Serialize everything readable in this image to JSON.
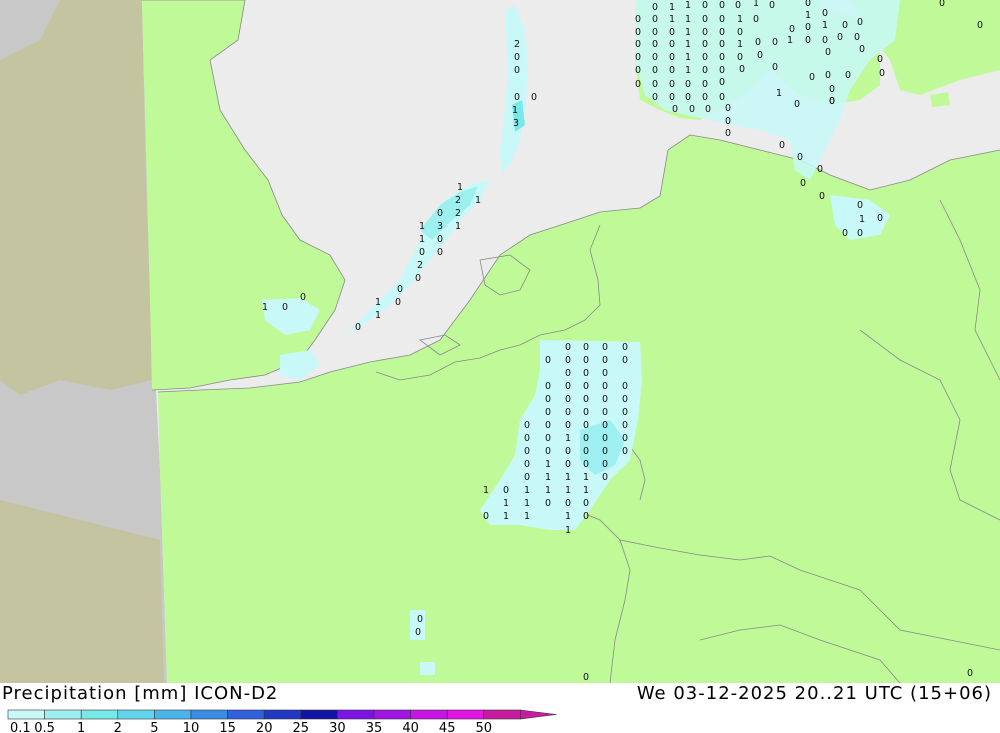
{
  "title": {
    "left": "Precipitation [mm] ICON-D2",
    "right": "We 03-12-2025 20..21 UTC (15+06)"
  },
  "colors": {
    "sea": "#ececec",
    "land": "#c0fa98",
    "outside_domain": "#c8c8c8",
    "out_land": "#c4c4a0",
    "border": "#888888"
  },
  "legend": {
    "ticks": [
      "0.1",
      "0.5",
      "1",
      "2",
      "5",
      "10",
      "15",
      "20",
      "25",
      "30",
      "35",
      "40",
      "45",
      "50"
    ],
    "colors": [
      "#c8f8f8",
      "#9ef0f0",
      "#78e8e8",
      "#64d4ec",
      "#4cb4ec",
      "#3c8ce4",
      "#3060dc",
      "#2038c4",
      "#1414a4",
      "#7c14e4",
      "#a014e4",
      "#c814e4",
      "#e414e4",
      "#c81ca0"
    ]
  },
  "values": [
    {
      "t": "0"
    },
    {
      "t": "1"
    },
    {
      "t": "1"
    },
    {
      "t": "0"
    },
    {
      "t": "0"
    },
    {
      "t": "0"
    },
    {
      "t": "1"
    },
    {
      "t": "0"
    },
    {
      "t": "0"
    },
    {
      "t": "0"
    },
    {
      "t": "0"
    },
    {
      "t": "0"
    },
    {
      "t": "1"
    },
    {
      "t": "1"
    },
    {
      "t": "0"
    },
    {
      "t": "0"
    },
    {
      "t": "1"
    },
    {
      "t": "0"
    },
    {
      "t": "1"
    },
    {
      "t": "0"
    },
    {
      "t": "0"
    },
    {
      "t": "0"
    },
    {
      "t": "0"
    },
    {
      "t": "0"
    },
    {
      "t": "0"
    },
    {
      "t": "1"
    },
    {
      "t": "0"
    },
    {
      "t": "0"
    },
    {
      "t": "0"
    },
    {
      "t": "0"
    },
    {
      "t": "0"
    },
    {
      "t": "1"
    },
    {
      "t": "0"
    },
    {
      "t": "0"
    },
    {
      "t": "0"
    },
    {
      "t": "0"
    },
    {
      "t": "0"
    },
    {
      "t": "1"
    },
    {
      "t": "0"
    },
    {
      "t": "0"
    },
    {
      "t": "1"
    },
    {
      "t": "0"
    },
    {
      "t": "0"
    },
    {
      "t": "1"
    },
    {
      "t": "0"
    },
    {
      "t": "0"
    },
    {
      "t": "0"
    },
    {
      "t": "0"
    },
    {
      "t": "0"
    },
    {
      "t": "0"
    },
    {
      "t": "1"
    },
    {
      "t": "0"
    },
    {
      "t": "0"
    },
    {
      "t": "0"
    },
    {
      "t": "0"
    },
    {
      "t": "0"
    },
    {
      "t": "0"
    },
    {
      "t": "0"
    },
    {
      "t": "0"
    },
    {
      "t": "0"
    },
    {
      "t": "0"
    },
    {
      "t": "1"
    },
    {
      "t": "0"
    },
    {
      "t": "0"
    },
    {
      "t": "0"
    },
    {
      "t": "0"
    },
    {
      "t": "0"
    },
    {
      "t": "0"
    },
    {
      "t": "0"
    },
    {
      "t": "0"
    },
    {
      "t": "0"
    },
    {
      "t": "0"
    },
    {
      "t": "0"
    },
    {
      "t": "0"
    },
    {
      "t": "0"
    },
    {
      "t": "0"
    },
    {
      "t": "0"
    },
    {
      "t": "0"
    },
    {
      "t": "0"
    },
    {
      "t": "0"
    },
    {
      "t": "0"
    },
    {
      "t": "0"
    },
    {
      "t": "0"
    },
    {
      "t": "1"
    },
    {
      "t": "0"
    },
    {
      "t": "0"
    },
    {
      "t": "0"
    },
    {
      "t": "0"
    },
    {
      "t": "0"
    },
    {
      "t": "0"
    },
    {
      "t": "0"
    },
    {
      "t": "0"
    },
    {
      "t": "0"
    },
    {
      "t": "0"
    },
    {
      "t": "0"
    },
    {
      "t": "0"
    },
    {
      "t": "0"
    },
    {
      "t": "0"
    },
    {
      "t": "1"
    },
    {
      "t": "0"
    },
    {
      "t": "0"
    },
    {
      "t": "0"
    },
    {
      "t": "0"
    },
    {
      "t": "0"
    },
    {
      "t": "0"
    },
    {
      "t": "0"
    },
    {
      "t": "0"
    },
    {
      "t": "0"
    },
    {
      "t": "0"
    },
    {
      "t": "0"
    },
    {
      "t": "0"
    },
    {
      "t": "0"
    },
    {
      "t": "0"
    },
    {
      "t": "0"
    },
    {
      "t": "0"
    },
    {
      "t": "2"
    },
    {
      "t": "0"
    },
    {
      "t": "0"
    },
    {
      "t": "0"
    },
    {
      "t": "0"
    },
    {
      "t": "1"
    },
    {
      "t": "3"
    },
    {
      "t": "1"
    },
    {
      "t": "2"
    },
    {
      "t": "1"
    },
    {
      "t": "0"
    },
    {
      "t": "2"
    },
    {
      "t": "1"
    },
    {
      "t": "3"
    },
    {
      "t": "1"
    },
    {
      "t": "1"
    },
    {
      "t": "0"
    },
    {
      "t": "0"
    },
    {
      "t": "0"
    },
    {
      "t": "2"
    },
    {
      "t": "0"
    },
    {
      "t": "0"
    },
    {
      "t": "1"
    },
    {
      "t": "0"
    },
    {
      "t": "1"
    },
    {
      "t": "0"
    },
    {
      "t": "0"
    },
    {
      "t": "1"
    },
    {
      "t": "0"
    },
    {
      "t": "0"
    },
    {
      "t": "0"
    },
    {
      "t": "0"
    },
    {
      "t": "0"
    },
    {
      "t": "0"
    },
    {
      "t": "0"
    },
    {
      "t": "0"
    },
    {
      "t": "0"
    },
    {
      "t": "0"
    },
    {
      "t": "0"
    },
    {
      "t": "0"
    },
    {
      "t": "0"
    },
    {
      "t": "0"
    },
    {
      "t": "0"
    },
    {
      "t": "0"
    },
    {
      "t": "0"
    },
    {
      "t": "0"
    },
    {
      "t": "0"
    },
    {
      "t": "0"
    },
    {
      "t": "0"
    },
    {
      "t": "0"
    },
    {
      "t": "0"
    },
    {
      "t": "0"
    },
    {
      "t": "1"
    },
    {
      "t": "0"
    },
    {
      "t": "0"
    },
    {
      "t": "0"
    },
    {
      "t": "0"
    },
    {
      "t": "0"
    },
    {
      "t": "0"
    },
    {
      "t": "0"
    },
    {
      "t": "0"
    },
    {
      "t": "0"
    },
    {
      "t": "0"
    },
    {
      "t": "1"
    },
    {
      "t": "0"
    },
    {
      "t": "0"
    },
    {
      "t": "0"
    },
    {
      "t": "0"
    },
    {
      "t": "1"
    },
    {
      "t": "1"
    },
    {
      "t": "1"
    },
    {
      "t": "0"
    },
    {
      "t": "1"
    },
    {
      "t": "0"
    },
    {
      "t": "1"
    },
    {
      "t": "1"
    },
    {
      "t": "1"
    },
    {
      "t": "1"
    },
    {
      "t": "1"
    },
    {
      "t": "1"
    },
    {
      "t": "0"
    },
    {
      "t": "0"
    },
    {
      "t": "0"
    },
    {
      "t": "0"
    },
    {
      "t": "1"
    },
    {
      "t": "1"
    },
    {
      "t": "1"
    },
    {
      "t": "0"
    },
    {
      "t": "1"
    },
    {
      "t": "0"
    },
    {
      "t": "0"
    },
    {
      "t": "0"
    },
    {
      "t": "0"
    },
    {
      "t": "0"
    },
    {
      "t": "0"
    },
    {
      "t": "0"
    },
    {
      "t": "0"
    },
    {
      "t": "0"
    },
    {
      "t": "0"
    },
    {
      "t": "0"
    },
    {
      "t": "0"
    },
    {
      "t": "0"
    }
  ]
}
